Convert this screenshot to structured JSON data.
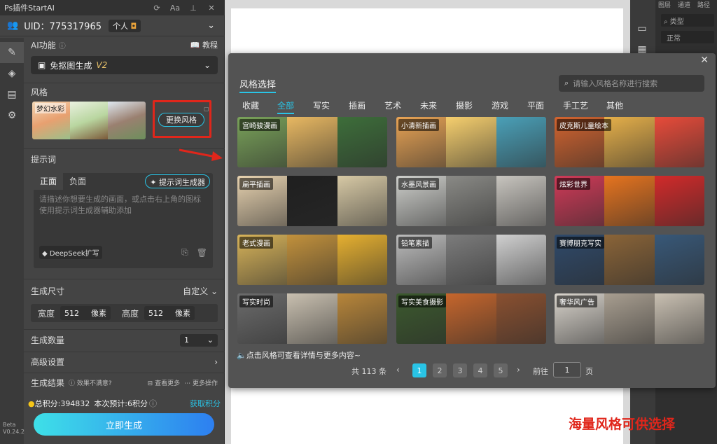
{
  "plugin": {
    "title": "Ps插件StartAI",
    "uid_label": "UID：775317965",
    "account_type": "个人",
    "ai_func_label": "AI功能",
    "tutorial_label": "教程",
    "mode_value": "免抠图生成",
    "mode_version": "V2",
    "style_label": "风格",
    "style_name": "梦幻水彩",
    "change_style": "更换风格",
    "prompt_label": "提示词",
    "tab_positive": "正面",
    "tab_negative": "负面",
    "prompt_generator": "提示词生成器",
    "prompt_placeholder": "请描述你想要生成的画面，或点击右上角的图标使用提示词生成器辅助添加",
    "deepseek_label": "DeepSeek扩写",
    "size_label": "生成尺寸",
    "size_mode": "自定义",
    "width_label": "宽度",
    "width_value": "512",
    "height_label": "高度",
    "height_value": "512",
    "unit": "像素",
    "count_label": "生成数量",
    "count_value": "1",
    "advanced_label": "高级设置",
    "result_label": "生成结果",
    "unsatisfied": "效果不满意?",
    "see_more": "查看更多",
    "more_ops": "更多操作",
    "total_points": "总积分:394832",
    "estimate": "本次预计:6积分",
    "get_points": "获取积分",
    "generate": "立即生成",
    "beta": "Beta",
    "version": "V0.24.2"
  },
  "rightpanel": {
    "tab1": "图层",
    "tab2": "通道",
    "tab3": "路径",
    "kind": "类型",
    "blend": "正常"
  },
  "modal": {
    "title": "风格选择",
    "search_placeholder": "请输入风格名称进行搜索",
    "categories": [
      "收藏",
      "全部",
      "写实",
      "插画",
      "艺术",
      "未来",
      "摄影",
      "游戏",
      "平面",
      "手工艺",
      "其他"
    ],
    "active_category": "全部",
    "styles": [
      "宫崎骏漫画",
      "小清新插画",
      "皮克斯儿童绘本",
      "扁平插画",
      "水墨风景画",
      "炫彩世界",
      "老式漫画",
      "铅笔素描",
      "赛博朋克写实",
      "写实时尚",
      "写实美食摄影",
      "奢华风广告"
    ],
    "hint": "点击风格可查看详情与更多内容~",
    "total": "共 113 条",
    "pages": [
      "1",
      "2",
      "3",
      "4",
      "5"
    ],
    "goto_label": "前往",
    "goto_value": "1",
    "page_unit": "页"
  },
  "annotation": "海量风格可供选择",
  "colors": {
    "accent": "#29c4e6",
    "highlight": "#e0261b",
    "panel": "#444444",
    "modal": "#535353"
  }
}
